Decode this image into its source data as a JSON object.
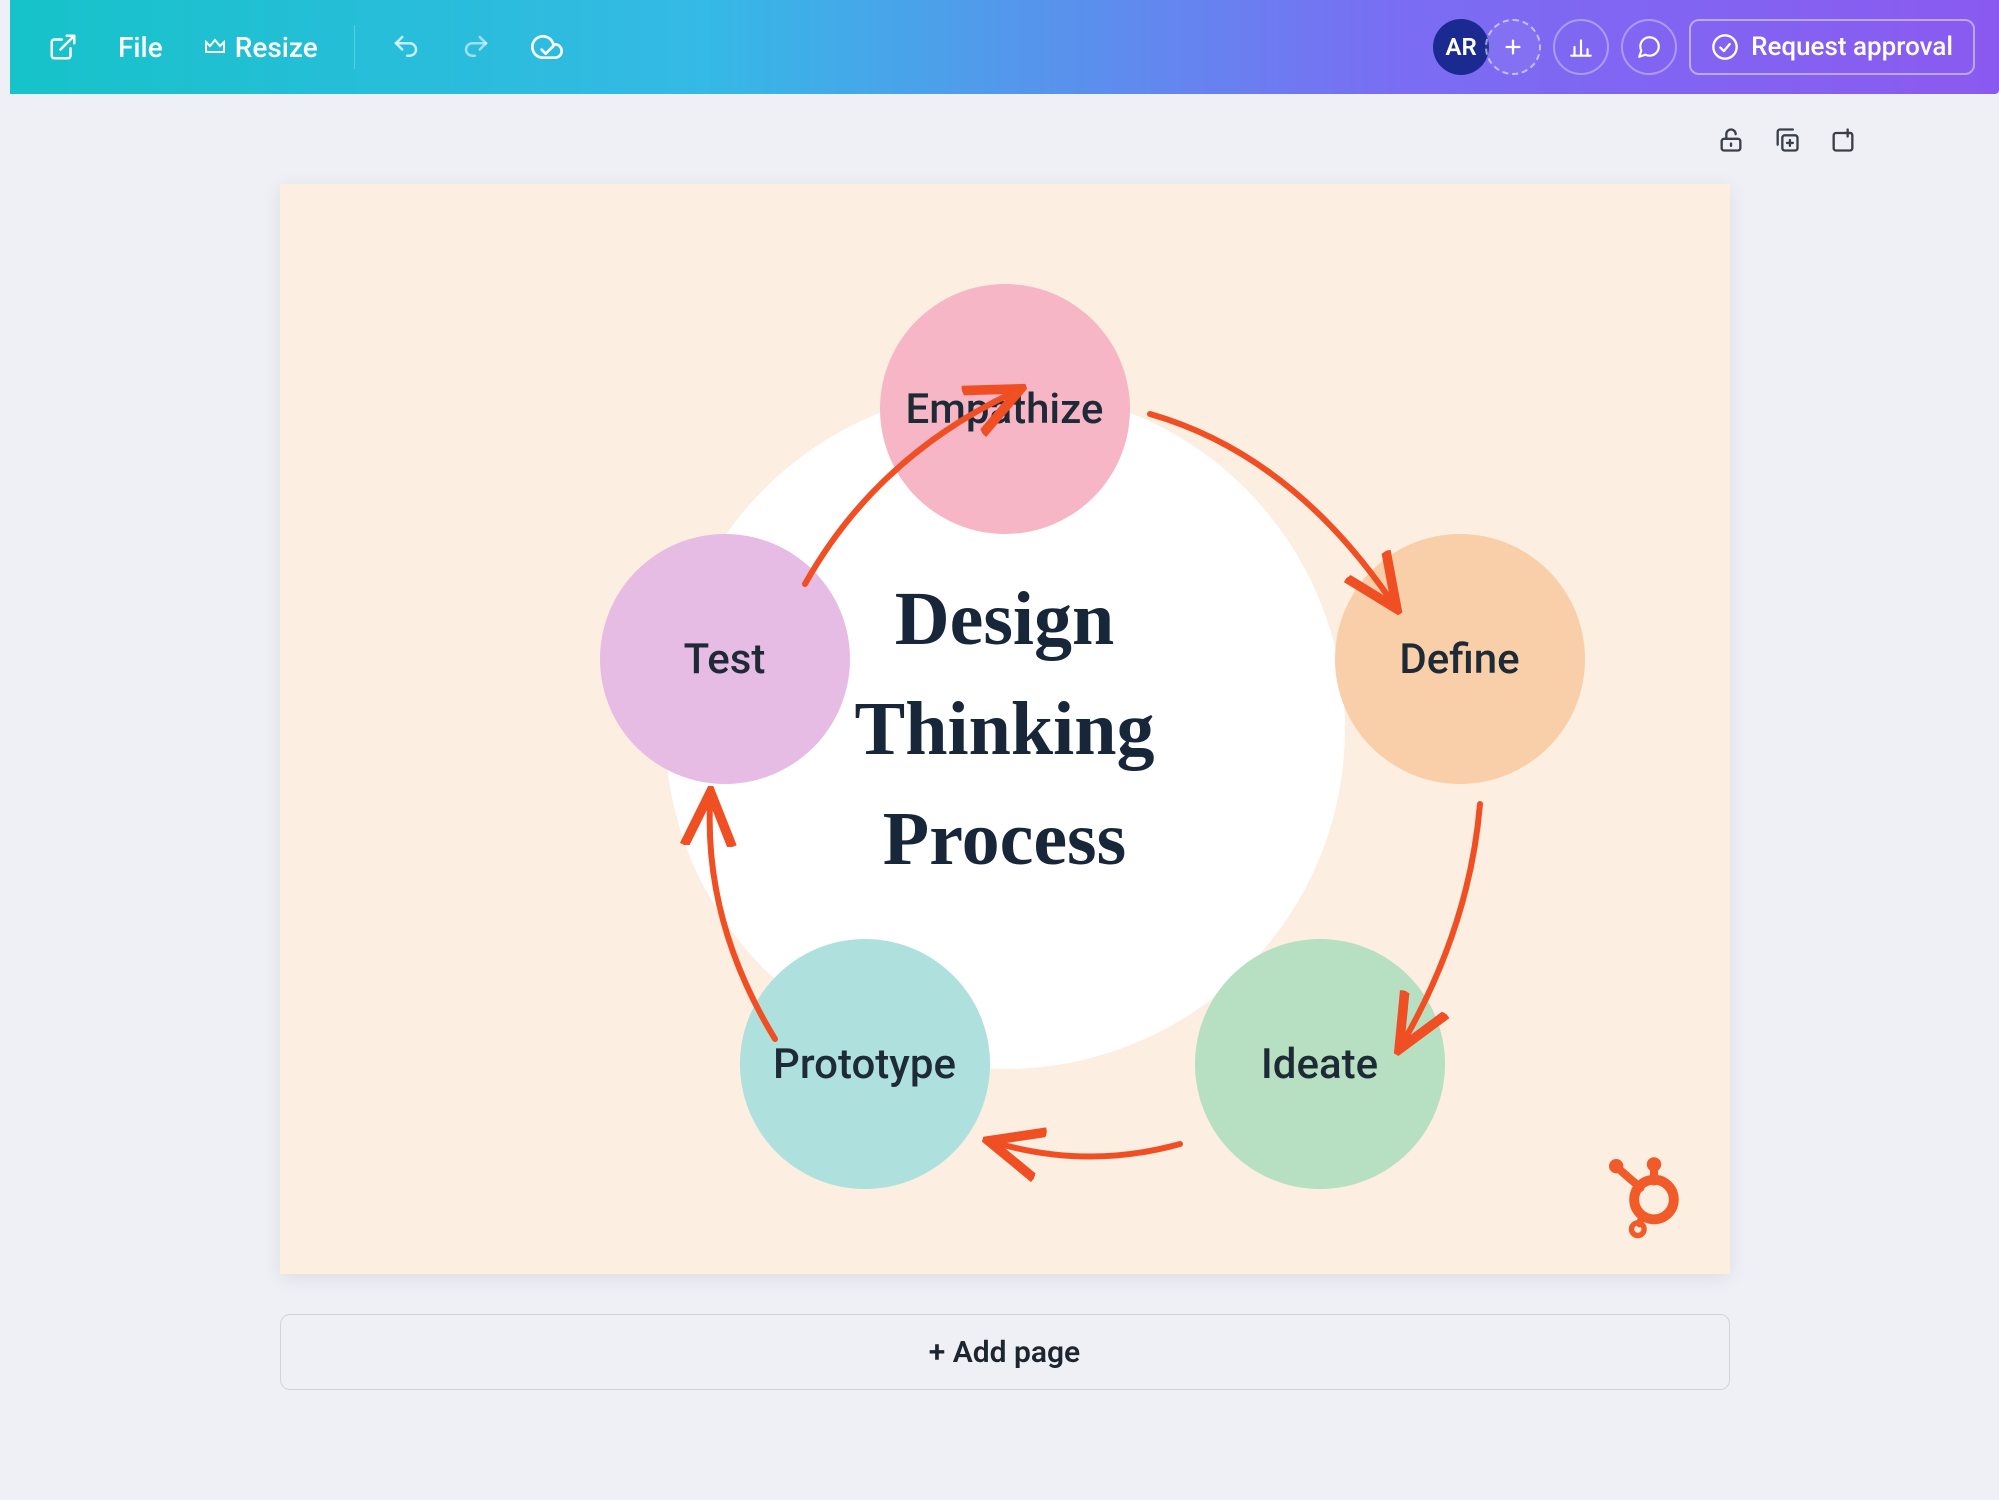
{
  "toolbar": {
    "file_label": "File",
    "resize_label": "Resize",
    "request_approval_label": "Request approval",
    "avatar_initials": "AR"
  },
  "canvas": {
    "center_title_line1": "Design",
    "center_title_line2": "Thinking",
    "center_title_line3": "Process",
    "nodes": {
      "empathize": "Empathize",
      "define": "Define",
      "ideate": "Ideate",
      "prototype": "Prototype",
      "test": "Test"
    },
    "colors": {
      "background": "#fceee0",
      "center": "#ffffff",
      "arrow": "#f04f23",
      "empathize": "#f6b6c6",
      "define": "#f8cfa8",
      "ideate": "#b7dfc2",
      "prototype": "#aee0dd",
      "test": "#e6bbe4"
    }
  },
  "footer": {
    "add_page_label": "+ Add page"
  }
}
